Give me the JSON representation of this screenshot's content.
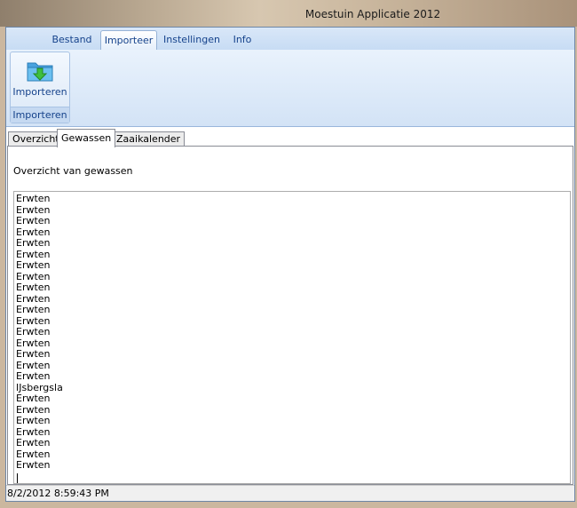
{
  "window": {
    "title": "Moestuin Applicatie 2012"
  },
  "ribbon": {
    "tabs": [
      {
        "label": "Bestand",
        "active": false
      },
      {
        "label": "Importeer",
        "active": true
      },
      {
        "label": "Instellingen",
        "active": false
      },
      {
        "label": "Info",
        "active": false
      }
    ],
    "group": {
      "button_label": "Importeren",
      "button_icon": "folder-import-icon",
      "caption": "Importeren"
    }
  },
  "tabs": [
    {
      "label": "Overzicht",
      "active": false
    },
    {
      "label": "Gewassen",
      "active": true
    },
    {
      "label": "Zaaikalender",
      "active": false
    }
  ],
  "gewassen": {
    "heading": "Overzicht van gewassen",
    "items": [
      "Erwten",
      "Erwten",
      "Erwten",
      "Erwten",
      "Erwten",
      "Erwten",
      "Erwten",
      "Erwten",
      "Erwten",
      "Erwten",
      "Erwten",
      "Erwten",
      "Erwten",
      "Erwten",
      "Erwten",
      "Erwten",
      "Erwten",
      "IJsbergsla",
      "Erwten",
      "Erwten",
      "Erwten",
      "Erwten",
      "Erwten",
      "Erwten",
      "Erwten"
    ]
  },
  "status": {
    "text": "8/2/2012 8:59:43 PM"
  },
  "colors": {
    "ribbon_text": "#15428b",
    "frame_border": "#6d86a6"
  }
}
